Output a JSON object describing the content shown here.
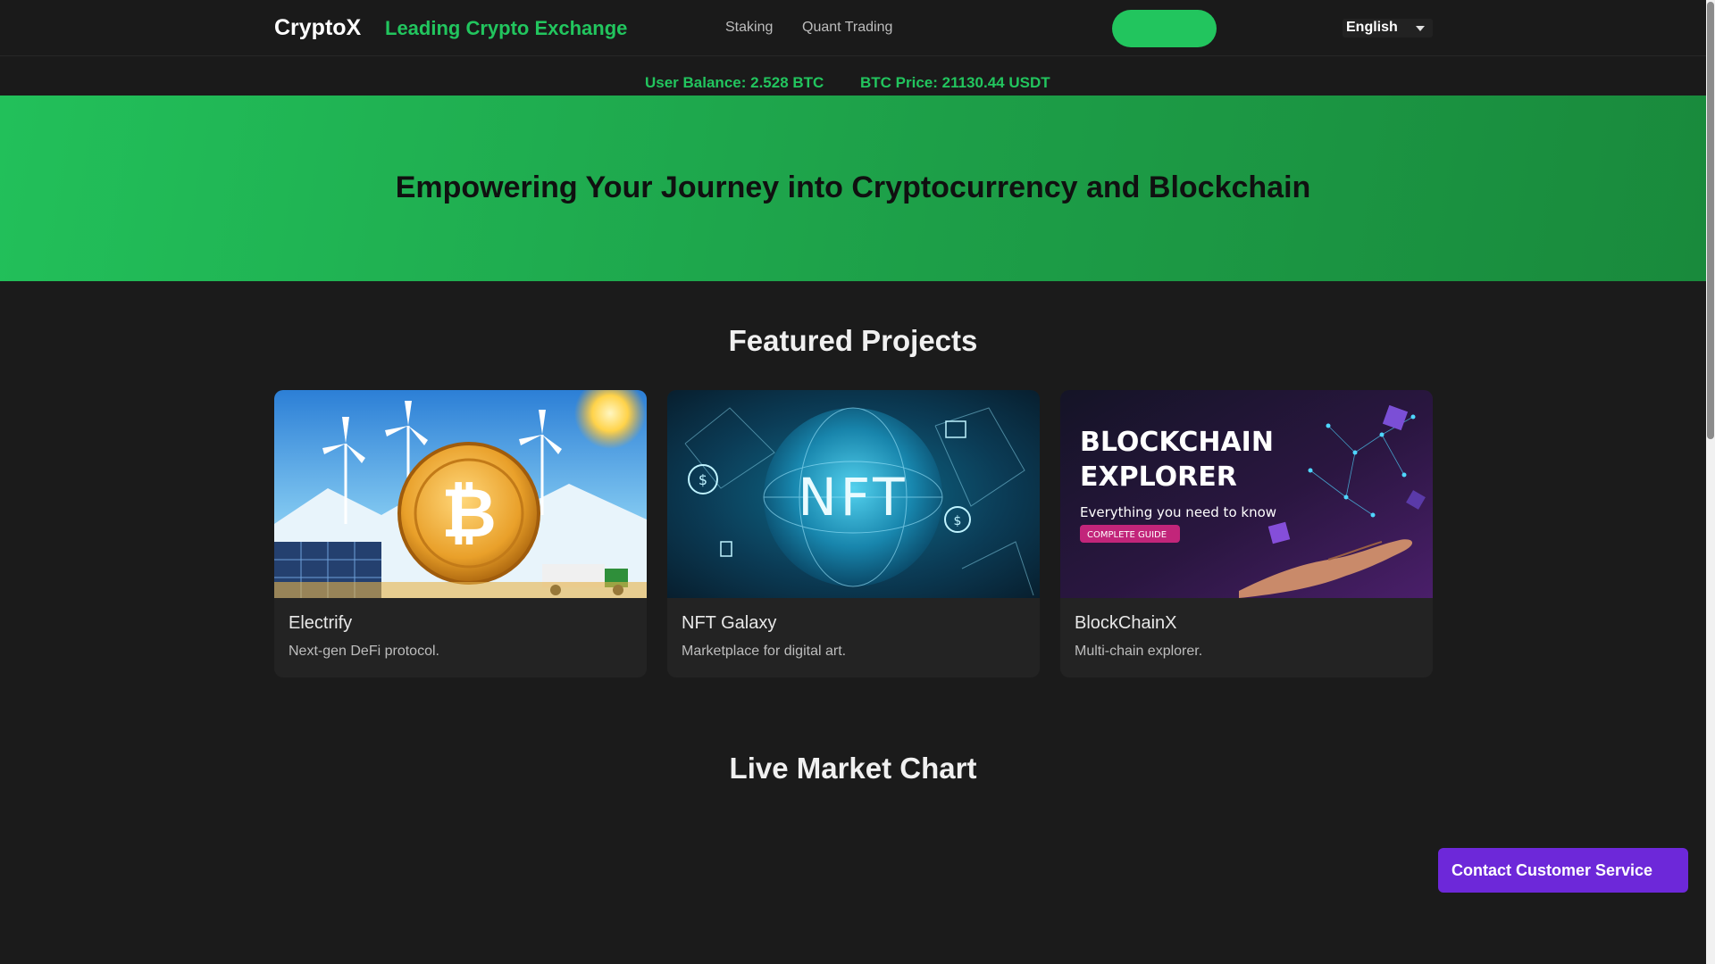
{
  "nav": {
    "brand": "CryptoX",
    "tagline": "Leading Crypto Exchange",
    "links": [
      "Staking",
      "Quant Trading"
    ],
    "cta_label": "",
    "language": "English"
  },
  "ticker": {
    "balance": "User Balance: 2.528 BTC",
    "price": "BTC Price: 21130.44 USDT"
  },
  "hero": {
    "title": "Empowering Your Journey into Cryptocurrency and Blockchain"
  },
  "featured": {
    "title": "Featured Projects",
    "projects": [
      {
        "name": "Electrify",
        "description": "Next-gen DeFi protocol.",
        "image": "bitcoin-energy-illustration"
      },
      {
        "name": "NFT Galaxy",
        "description": "Marketplace for digital art.",
        "image": "nft-globe-illustration"
      },
      {
        "name": "BlockChainX",
        "description": "Multi-chain explorer.",
        "image": "blockchain-explorer-banner",
        "image_text": {
          "headline_1": "BLOCKCHAIN",
          "headline_2": "EXPLORER",
          "subtitle": "Everything you need to know",
          "tag": "COMPLETE GUIDE"
        }
      }
    ]
  },
  "market": {
    "title": "Live Market Chart"
  },
  "contact": {
    "label": "Contact Customer Service"
  },
  "colors": {
    "accent": "#22c55e",
    "background": "#1b1b1b",
    "card": "#232323",
    "contact": "#6d28d9"
  }
}
